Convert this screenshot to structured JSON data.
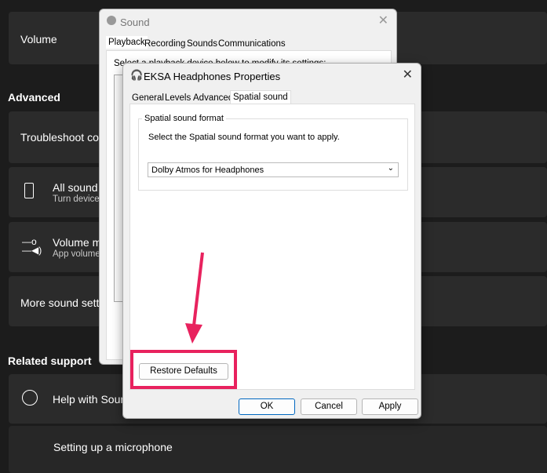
{
  "settings": {
    "volume": "Volume",
    "advanced_heading": "Advanced",
    "troubleshoot": "Troubleshoot common sound problems",
    "all_sound": {
      "title": "All sound devices",
      "sub": "Turn devices on and off"
    },
    "volume_mixer": {
      "title": "Volume mixer",
      "sub": "App volume mix"
    },
    "more_sound": "More sound settings",
    "related_heading": "Related support",
    "help_sound": "Help with Sound",
    "microphone": "Setting up a microphone"
  },
  "sound_dialog": {
    "title": "Sound",
    "tabs": [
      "Playback",
      "Recording",
      "Sounds",
      "Communications"
    ],
    "instruction": "Select a playback device below to modify its settings:"
  },
  "props_dialog": {
    "title": "EKSA Headphones Properties",
    "tabs": [
      "General",
      "Levels",
      "Advanced",
      "Spatial sound"
    ],
    "group_label": "Spatial sound format",
    "instruction": "Select the Spatial sound format you want to apply.",
    "format_value": "Dolby Atmos for Headphones",
    "restore": "Restore Defaults",
    "ok": "OK",
    "cancel": "Cancel",
    "apply": "Apply"
  },
  "colors": {
    "highlight": "#e8225e"
  }
}
